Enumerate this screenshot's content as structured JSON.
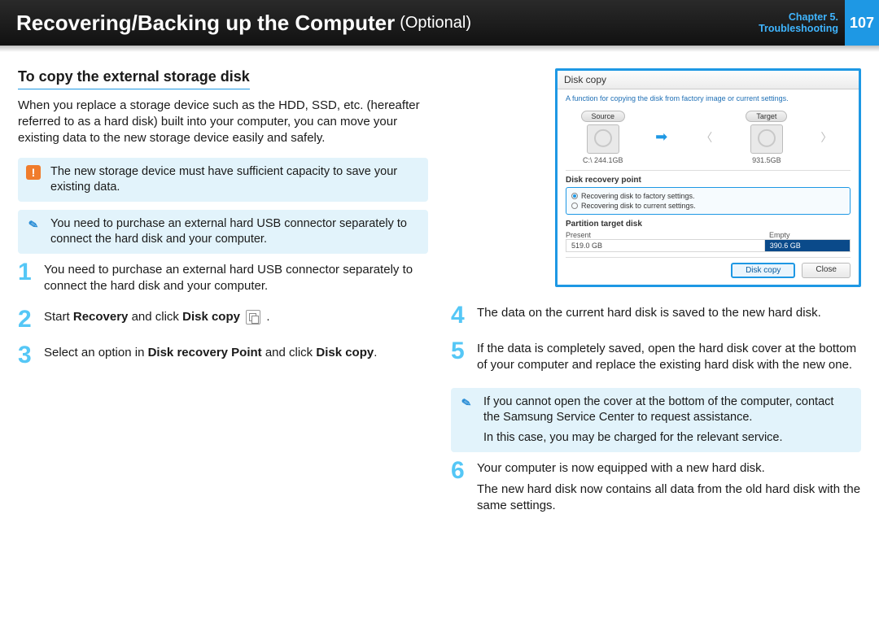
{
  "header": {
    "title": "Recovering/Backing up the Computer",
    "subtitle": "(Optional)",
    "chapter_line1": "Chapter 5.",
    "chapter_line2": "Troubleshooting",
    "page": "107"
  },
  "section_heading": "To copy the external storage disk",
  "intro": "When you replace a storage device such as the HDD, SSD, etc. (hereafter referred to as a hard disk) built into your computer, you can move your existing data to the new storage device easily and safely.",
  "notes": {
    "warn": "The new storage device must have sufficient capacity to save your existing data.",
    "info1": "You need to purchase an external hard USB connector separately to connect the hard disk and your computer.",
    "info2_a": "If you cannot open the cover at the bottom of the computer, contact the Samsung Service Center to request assistance.",
    "info2_b": "In this case, you may be charged for the relevant service."
  },
  "steps": {
    "s1": "You need to purchase an external hard USB connector separately to connect the hard disk and your computer.",
    "s2_a": "Start ",
    "s2_b": "Recovery",
    "s2_c": " and click ",
    "s2_d": "Disk copy",
    "s2_e": " .",
    "s3_a": "Select an option in ",
    "s3_b": "Disk recovery Point",
    "s3_c": " and click ",
    "s3_d": "Disk copy",
    "s3_e": ".",
    "s4": "The data on the current hard disk is saved to the new hard disk.",
    "s5": "If the data is completely saved, open the hard disk cover at the bottom of your computer and replace the existing hard disk with the new one.",
    "s6_a": "Your computer is now equipped with a new hard disk.",
    "s6_b": "The new hard disk now contains all data from the old hard disk with the same settings."
  },
  "screenshot": {
    "title": "Disk copy",
    "desc": "A function for copying the disk from factory image or current settings.",
    "source_label": "Source",
    "target_label": "Target",
    "source_cap": "C:\\ 244.1GB",
    "target_cap": "931.5GB",
    "recovery_heading": "Disk recovery point",
    "opt1": "Recovering disk to factory settings.",
    "opt2": "Recovering disk to current settings.",
    "partition_heading": "Partition target disk",
    "part_present": "Present",
    "part_empty": "Empty",
    "part_present_val": "519.0 GB",
    "part_empty_val": "390.6 GB",
    "btn_primary": "Disk copy",
    "btn_close": "Close"
  }
}
